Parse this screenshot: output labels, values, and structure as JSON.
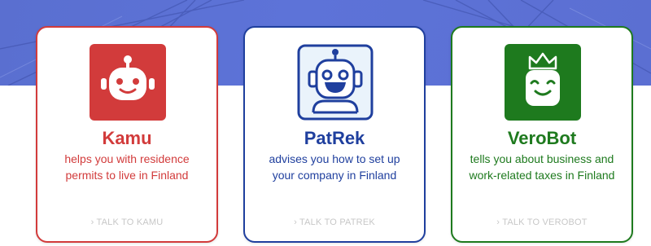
{
  "colors": {
    "hero_bg": "#5b70d4",
    "kamu": "#d23b3b",
    "patrek": "#1f3f9e",
    "verobot": "#1e7a1e",
    "cta": "#c7c7c7"
  },
  "bots": [
    {
      "id": "kamu",
      "name": "Kamu",
      "description": "helps you with residence permits to live in Finland",
      "cta": "TALK TO KAMU",
      "icon": "robot-face-icon"
    },
    {
      "id": "patrek",
      "name": "PatRek",
      "description": "advises you how to set up your company in Finland",
      "cta": "TALK TO PATREK",
      "icon": "robot-headset-icon"
    },
    {
      "id": "verobot",
      "name": "VeroBot",
      "description": "tells you about business and work-related taxes in Finland",
      "cta": "TALK TO VEROBOT",
      "icon": "crowned-bot-icon"
    }
  ]
}
